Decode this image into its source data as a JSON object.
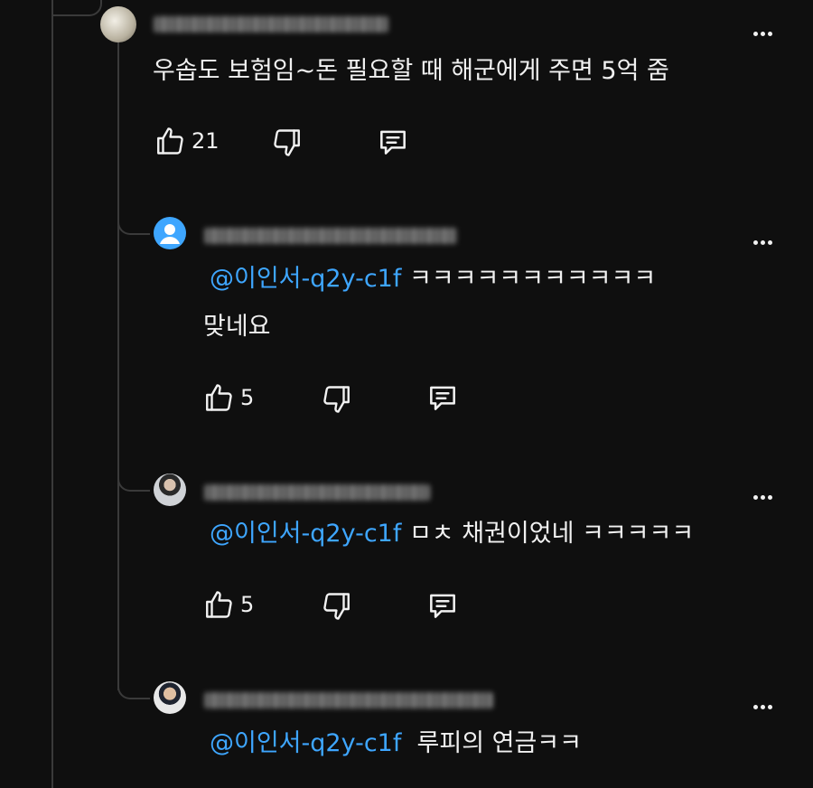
{
  "comments": [
    {
      "text": "우솝도 보험임~돈 필요할 때 해군에게 주면 5억 줌",
      "likes": "21"
    },
    {
      "mention": "@이인서-q2y-c1f",
      "text": " ㅋㅋㅋㅋㅋㅋㅋㅋㅋㅋㅋ",
      "text2": "맞네요",
      "likes": "5"
    },
    {
      "mention": "@이인서-q2y-c1f",
      "text": " ㅁㅊ 채권이었네 ㅋㅋㅋㅋㅋ",
      "likes": "5"
    },
    {
      "mention": "@이인서-q2y-c1f",
      "text": "  루피의 연금ㅋㅋ"
    }
  ],
  "icons": {
    "like": "thumbs-up-icon",
    "dislike": "thumbs-down-icon",
    "reply": "reply-icon",
    "more": "more-vertical-icon"
  },
  "colors": {
    "background": "#0f0f0f",
    "text": "#f1f1f1",
    "mention": "#3ea6ff",
    "thread_line": "#3a3a3a",
    "default_avatar": "#3ea6ff"
  }
}
